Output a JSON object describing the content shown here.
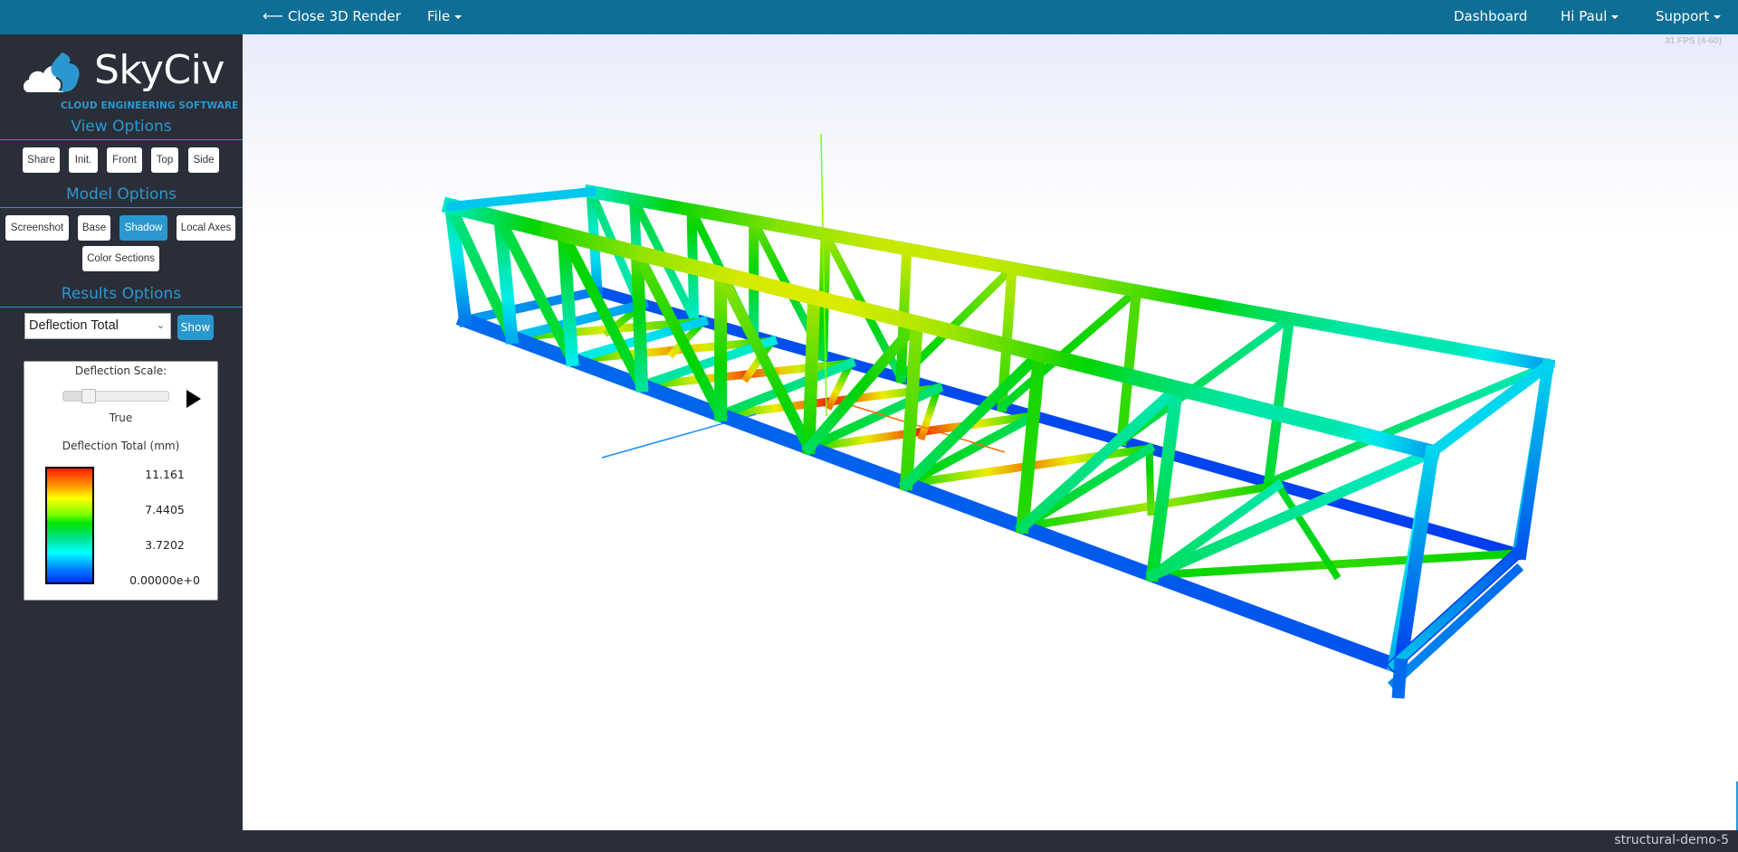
{
  "topbar": {
    "close_label": "Close 3D Render",
    "close_icon": "arrow-left-icon",
    "file_label": "File",
    "dashboard_label": "Dashboard",
    "user_label": "Hi Paul",
    "support_label": "Support"
  },
  "logo": {
    "name": "SkyCiv",
    "tagline": "CLOUD ENGINEERING SOFTWARE"
  },
  "view_options": {
    "title": "View Options",
    "buttons": [
      "Share",
      "Init.",
      "Front",
      "Top",
      "Side"
    ]
  },
  "model_options": {
    "title": "Model Options",
    "buttons": [
      "Screenshot",
      "Base",
      "Shadow",
      "Local Axes",
      "Color Sections"
    ],
    "active": "Shadow"
  },
  "results_options": {
    "title": "Results Options",
    "selected_result": "Deflection Total",
    "show_label": "Show"
  },
  "legend": {
    "scale_label": "Deflection Scale:",
    "scale_value_label": "True",
    "scale_slider_fraction": 0.2,
    "title": "Deflection Total (mm)",
    "ticks": [
      "11.161",
      "7.4405",
      "3.7202",
      "0.00000e+0"
    ],
    "max": 11.161,
    "min": 0,
    "colors": [
      "#0030ff",
      "#00ffff",
      "#00e400",
      "#ffff00",
      "#ff2000"
    ]
  },
  "viewport": {
    "fps": "31 FPS (4-60)"
  },
  "footer": {
    "project_name": "structural-demo-5"
  }
}
